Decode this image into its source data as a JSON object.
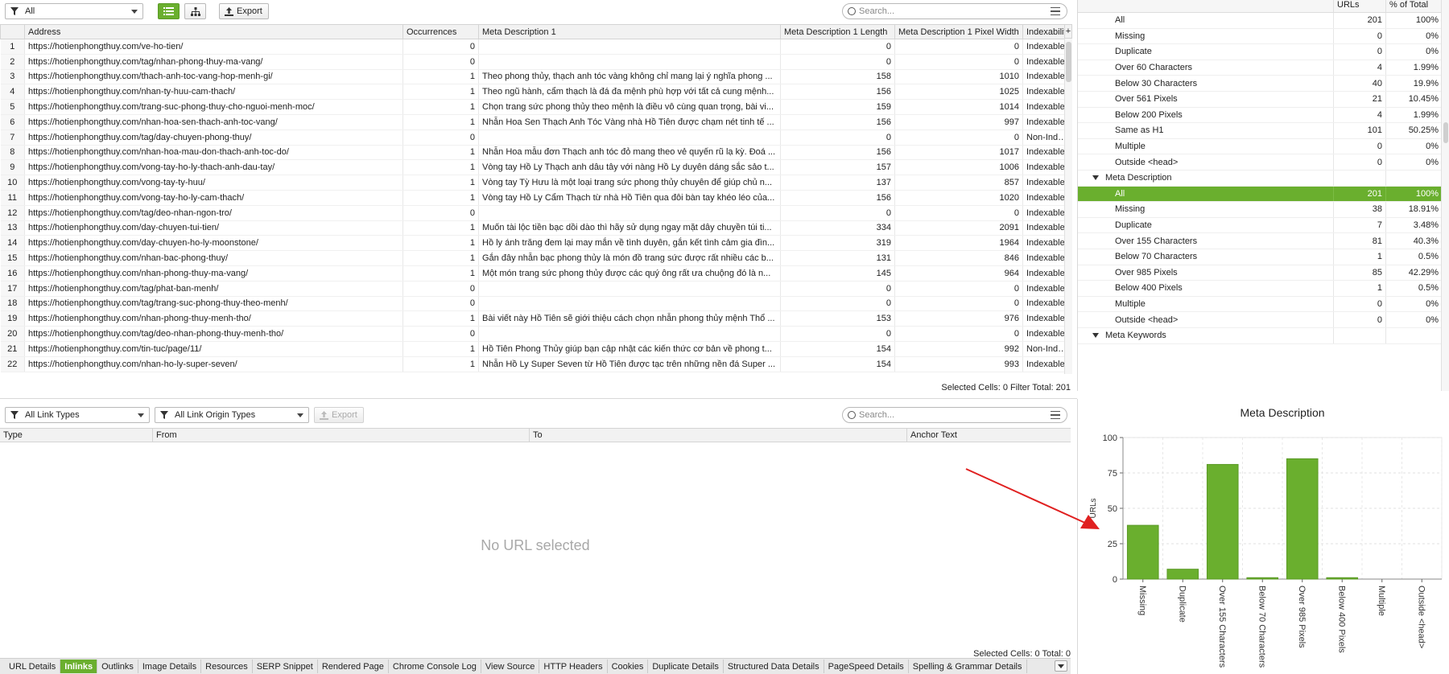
{
  "toolbar": {
    "filter_value": "All",
    "export_label": "Export",
    "search_placeholder": "Search..."
  },
  "grid": {
    "columns": [
      "Address",
      "Occurrences",
      "Meta Description 1",
      "Meta Description 1 Length",
      "Meta Description 1 Pixel Width",
      "Indexability"
    ],
    "rows": [
      [
        "1",
        "https://hotienphongthuy.com/ve-ho-tien/",
        "0",
        "",
        "0",
        "0",
        "Indexable"
      ],
      [
        "2",
        "https://hotienphongthuy.com/tag/nhan-phong-thuy-ma-vang/",
        "0",
        "",
        "0",
        "0",
        "Indexable"
      ],
      [
        "3",
        "https://hotienphongthuy.com/thach-anh-toc-vang-hop-menh-gi/",
        "1",
        "Theo phong thủy, thạch anh tóc vàng không chỉ mang lại ý nghĩa phong ...",
        "158",
        "1010",
        "Indexable"
      ],
      [
        "4",
        "https://hotienphongthuy.com/nhan-ty-huu-cam-thach/",
        "1",
        "Theo ngũ hành, cẩm thạch là đá đa mệnh phù hợp với tất cả cung mệnh...",
        "156",
        "1025",
        "Indexable"
      ],
      [
        "5",
        "https://hotienphongthuy.com/trang-suc-phong-thuy-cho-nguoi-menh-moc/",
        "1",
        "Chọn trang sức phong thủy theo mệnh là điều vô cùng quan trọng, bài vi...",
        "159",
        "1014",
        "Indexable"
      ],
      [
        "6",
        "https://hotienphongthuy.com/nhan-hoa-sen-thach-anh-toc-vang/",
        "1",
        "Nhẫn Hoa Sen Thạch Anh Tóc Vàng nhà Hồ Tiên được chạm nét tinh tế ...",
        "156",
        "997",
        "Indexable"
      ],
      [
        "7",
        "https://hotienphongthuy.com/tag/day-chuyen-phong-thuy/",
        "0",
        "",
        "0",
        "0",
        "Non-Indexable"
      ],
      [
        "8",
        "https://hotienphongthuy.com/nhan-hoa-mau-don-thach-anh-toc-do/",
        "1",
        "Nhẫn Hoa mẫu đơn Thạch anh tóc đỏ mang theo vẻ quyến rũ lạ kỳ. Đoá ...",
        "156",
        "1017",
        "Indexable"
      ],
      [
        "9",
        "https://hotienphongthuy.com/vong-tay-ho-ly-thach-anh-dau-tay/",
        "1",
        "Vòng tay Hồ Ly Thạch anh dâu tây với nàng Hồ Ly duyên dáng sắc sảo t...",
        "157",
        "1006",
        "Indexable"
      ],
      [
        "10",
        "https://hotienphongthuy.com/vong-tay-ty-huu/",
        "1",
        "Vòng tay Tỳ Hưu là một loại trang sức phong thủy chuyên để giúp chủ n...",
        "137",
        "857",
        "Indexable"
      ],
      [
        "11",
        "https://hotienphongthuy.com/vong-tay-ho-ly-cam-thach/",
        "1",
        "Vòng tay Hồ Ly Cẩm Thạch từ nhà Hồ Tiên qua đôi bàn tay khéo léo của...",
        "156",
        "1020",
        "Indexable"
      ],
      [
        "12",
        "https://hotienphongthuy.com/tag/deo-nhan-ngon-tro/",
        "0",
        "",
        "0",
        "0",
        "Indexable"
      ],
      [
        "13",
        "https://hotienphongthuy.com/day-chuyen-tui-tien/",
        "1",
        "Muốn tài lộc tiền bạc dồi dào thì hãy sử dụng ngay mặt dây chuyền túi ti...",
        "334",
        "2091",
        "Indexable"
      ],
      [
        "14",
        "https://hotienphongthuy.com/day-chuyen-ho-ly-moonstone/",
        "1",
        "Hồ ly ánh trăng đem lại may mắn về tình duyên, gắn kết tình cảm gia đìn...",
        "319",
        "1964",
        "Indexable"
      ],
      [
        "15",
        "https://hotienphongthuy.com/nhan-bac-phong-thuy/",
        "1",
        "Gắn đây nhẫn bạc phong thủy là món đồ trang sức được rất nhiều các b...",
        "131",
        "846",
        "Indexable"
      ],
      [
        "16",
        "https://hotienphongthuy.com/nhan-phong-thuy-ma-vang/",
        "1",
        "Một món trang sức phong thủy được các quý ông rất ưa chuộng đó là n...",
        "145",
        "964",
        "Indexable"
      ],
      [
        "17",
        "https://hotienphongthuy.com/tag/phat-ban-menh/",
        "0",
        "",
        "0",
        "0",
        "Indexable"
      ],
      [
        "18",
        "https://hotienphongthuy.com/tag/trang-suc-phong-thuy-theo-menh/",
        "0",
        "",
        "0",
        "0",
        "Indexable"
      ],
      [
        "19",
        "https://hotienphongthuy.com/nhan-phong-thuy-menh-tho/",
        "1",
        "Bài viết này Hồ Tiên sẽ giới thiệu cách chọn nhẫn phong thủy mệnh Thổ ...",
        "153",
        "976",
        "Indexable"
      ],
      [
        "20",
        "https://hotienphongthuy.com/tag/deo-nhan-phong-thuy-menh-tho/",
        "0",
        "",
        "0",
        "0",
        "Indexable"
      ],
      [
        "21",
        "https://hotienphongthuy.com/tin-tuc/page/11/",
        "1",
        "Hồ Tiên Phong Thủy giúp bạn cập nhật các kiến thức cơ bản về phong t...",
        "154",
        "992",
        "Non-Indexable"
      ],
      [
        "22",
        "https://hotienphongthuy.com/nhan-ho-ly-super-seven/",
        "1",
        "Nhẫn Hồ Ly Super Seven từ Hồ Tiên được tạc trên những nền đá Super ...",
        "154",
        "993",
        "Indexable"
      ]
    ],
    "status": "Selected Cells:  0   Filter Total:  201"
  },
  "overview": {
    "col_urls": "URLs",
    "col_pct": "% of Total",
    "rows": [
      {
        "label": "All",
        "urls": "201",
        "pct": "100%",
        "kind": "item"
      },
      {
        "label": "Missing",
        "urls": "0",
        "pct": "0%",
        "kind": "item"
      },
      {
        "label": "Duplicate",
        "urls": "0",
        "pct": "0%",
        "kind": "item"
      },
      {
        "label": "Over 60 Characters",
        "urls": "4",
        "pct": "1.99%",
        "kind": "item"
      },
      {
        "label": "Below 30 Characters",
        "urls": "40",
        "pct": "19.9%",
        "kind": "item"
      },
      {
        "label": "Over 561 Pixels",
        "urls": "21",
        "pct": "10.45%",
        "kind": "item"
      },
      {
        "label": "Below 200 Pixels",
        "urls": "4",
        "pct": "1.99%",
        "kind": "item"
      },
      {
        "label": "Same as H1",
        "urls": "101",
        "pct": "50.25%",
        "kind": "item"
      },
      {
        "label": "Multiple",
        "urls": "0",
        "pct": "0%",
        "kind": "item"
      },
      {
        "label": "Outside <head>",
        "urls": "0",
        "pct": "0%",
        "kind": "item"
      },
      {
        "label": "Meta Description",
        "urls": "",
        "pct": "",
        "kind": "section"
      },
      {
        "label": "All",
        "urls": "201",
        "pct": "100%",
        "kind": "selected"
      },
      {
        "label": "Missing",
        "urls": "38",
        "pct": "18.91%",
        "kind": "item"
      },
      {
        "label": "Duplicate",
        "urls": "7",
        "pct": "3.48%",
        "kind": "item"
      },
      {
        "label": "Over 155 Characters",
        "urls": "81",
        "pct": "40.3%",
        "kind": "item"
      },
      {
        "label": "Below 70 Characters",
        "urls": "1",
        "pct": "0.5%",
        "kind": "item"
      },
      {
        "label": "Over 985 Pixels",
        "urls": "85",
        "pct": "42.29%",
        "kind": "item"
      },
      {
        "label": "Below 400 Pixels",
        "urls": "1",
        "pct": "0.5%",
        "kind": "item"
      },
      {
        "label": "Multiple",
        "urls": "0",
        "pct": "0%",
        "kind": "item"
      },
      {
        "label": "Outside <head>",
        "urls": "0",
        "pct": "0%",
        "kind": "item"
      },
      {
        "label": "Meta Keywords",
        "urls": "",
        "pct": "",
        "kind": "section"
      }
    ]
  },
  "lower": {
    "link_types": "All Link Types",
    "link_origin_types": "All Link Origin Types",
    "export_label": "Export",
    "search_placeholder": "Search...",
    "columns": [
      "Type",
      "From",
      "To",
      "Anchor Text"
    ],
    "empty_text": "No URL selected",
    "status": "Selected Cells:  0   Total:  0"
  },
  "tabs": [
    "URL Details",
    "Inlinks",
    "Outlinks",
    "Image Details",
    "Resources",
    "SERP Snippet",
    "Rendered Page",
    "Chrome Console Log",
    "View Source",
    "HTTP Headers",
    "Cookies",
    "Duplicate Details",
    "Structured Data Details",
    "PageSpeed Details",
    "Spelling & Grammar Details"
  ],
  "active_tab": "Inlinks",
  "colors": {
    "accent": "#6aaf2e",
    "bar": "#6aaf2e",
    "arrow": "#e02020"
  },
  "chart_data": {
    "type": "bar",
    "title": "Meta Description",
    "ylabel": "URLs",
    "xlabel": "",
    "categories": [
      "Missing",
      "Duplicate",
      "Over 155 Characters",
      "Below 70 Characters",
      "Over 985 Pixels",
      "Below 400 Pixels",
      "Multiple",
      "Outside <head>"
    ],
    "values": [
      38,
      7,
      81,
      1,
      85,
      1,
      0,
      0
    ],
    "ylim": [
      0,
      100
    ],
    "yticks": [
      "0",
      "25",
      "50",
      "75",
      "100"
    ],
    "grid": true
  }
}
